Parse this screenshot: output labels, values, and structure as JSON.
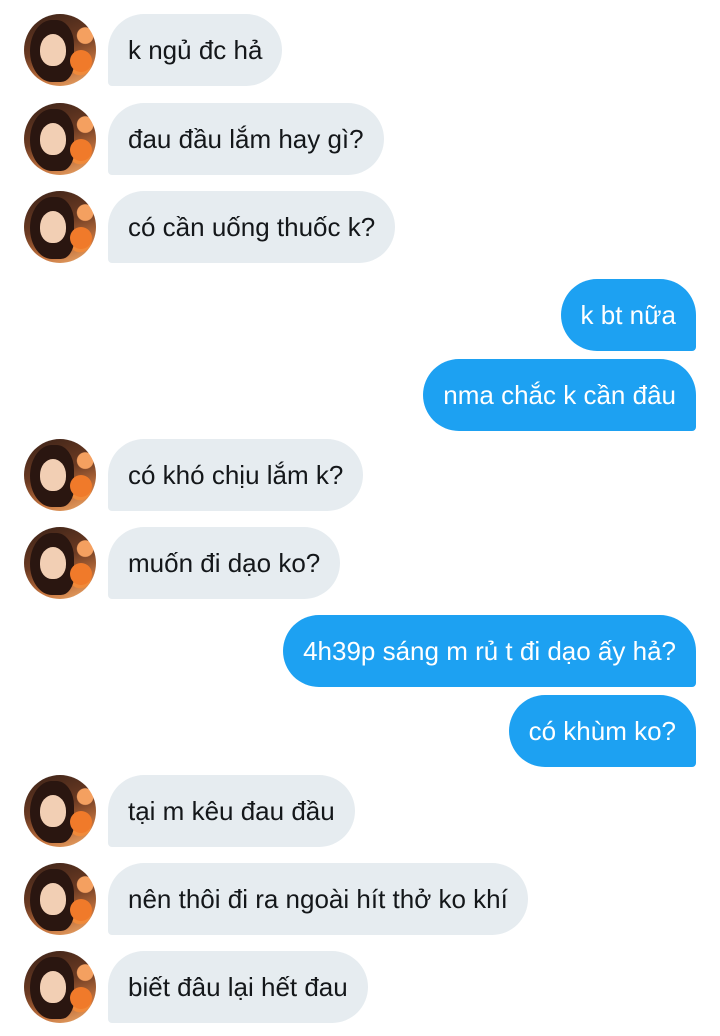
{
  "conversation": {
    "messages": [
      {
        "direction": "in",
        "text": "k ngủ đc hả"
      },
      {
        "direction": "in",
        "text": "đau đầu lắm hay gì?"
      },
      {
        "direction": "in",
        "text": "có cần uống thuốc k?"
      },
      {
        "direction": "out",
        "text": "k bt nữa"
      },
      {
        "direction": "out",
        "text": "nma chắc k cần đâu"
      },
      {
        "direction": "in",
        "text": "có khó chịu lắm k?"
      },
      {
        "direction": "in",
        "text": "muốn đi dạo ko?"
      },
      {
        "direction": "out",
        "text": "4h39p sáng m rủ t đi dạo ấy hả?"
      },
      {
        "direction": "out",
        "text": "có khùm ko?"
      },
      {
        "direction": "in",
        "text": "tại m kêu đau đầu"
      },
      {
        "direction": "in",
        "text": "nên thôi đi ra ngoài hít thở ko khí"
      },
      {
        "direction": "in",
        "text": "biết đâu lại hết đau"
      }
    ]
  },
  "colors": {
    "incoming_bubble": "#e6ecf0",
    "outgoing_bubble": "#1da1f2",
    "incoming_text": "#14171a",
    "outgoing_text": "#ffffff"
  },
  "icons": {
    "avatar": "contact-avatar-photo"
  }
}
